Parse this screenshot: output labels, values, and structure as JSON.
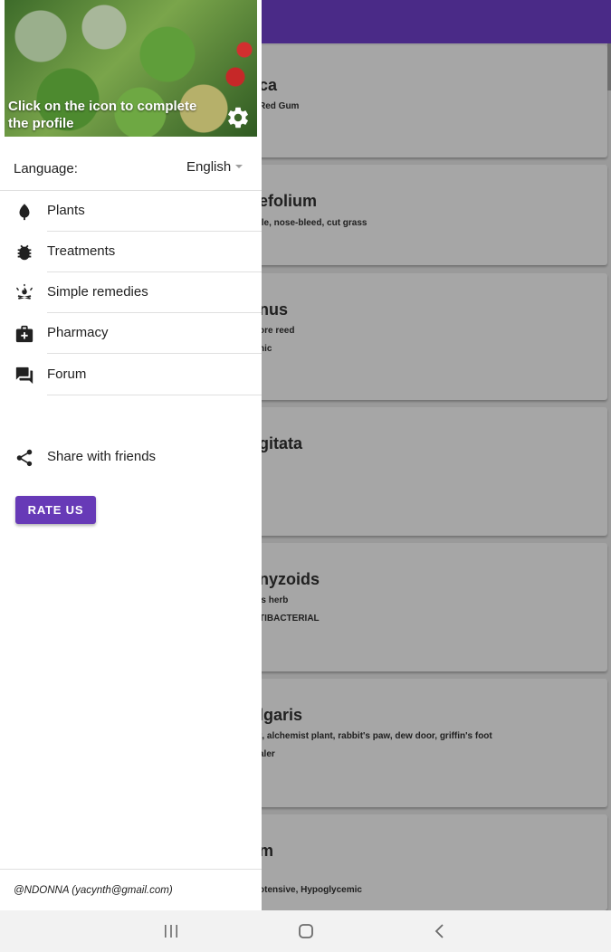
{
  "drawer": {
    "header_text": "Click on the icon to complete the profile",
    "language_label": "Language:",
    "language_value": "English",
    "menu": [
      {
        "label": "Plants",
        "icon": "leaf-icon"
      },
      {
        "label": "Treatments",
        "icon": "bug-icon"
      },
      {
        "label": "Simple remedies",
        "icon": "campfire-icon"
      },
      {
        "label": "Pharmacy",
        "icon": "medical-bag-icon"
      },
      {
        "label": "Forum",
        "icon": "forum-icon"
      }
    ],
    "share_label": "Share with friends",
    "rate_label": "RATE US",
    "footer": "@NDONNA (yacynth@gmail.com)",
    "accent_color": "#673ab7"
  },
  "app_bar_color": "#4a2a87",
  "cards": [
    {
      "title": "ca",
      "line1": "Red Gum",
      "line2": ""
    },
    {
      "title": "efolium",
      "line1": "lle, nose-bleed, cut grass",
      "line2": ""
    },
    {
      "title": "nus",
      "line1": "ore reed",
      "line2": "nic"
    },
    {
      "title": "gitata",
      "line1": "",
      "line2": ""
    },
    {
      "title": "nyzoids",
      "line1": "'s herb",
      "line2": "TIBACTERIAL"
    },
    {
      "title": "lgaris",
      "line1": "t, alchemist plant, rabbit's paw, dew door, griffin's foot",
      "line2": "aler"
    },
    {
      "title": "m",
      "line1": "",
      "line2": "otensive, Hypoglycemic"
    }
  ],
  "system_nav": [
    "recent-apps",
    "home",
    "back"
  ]
}
